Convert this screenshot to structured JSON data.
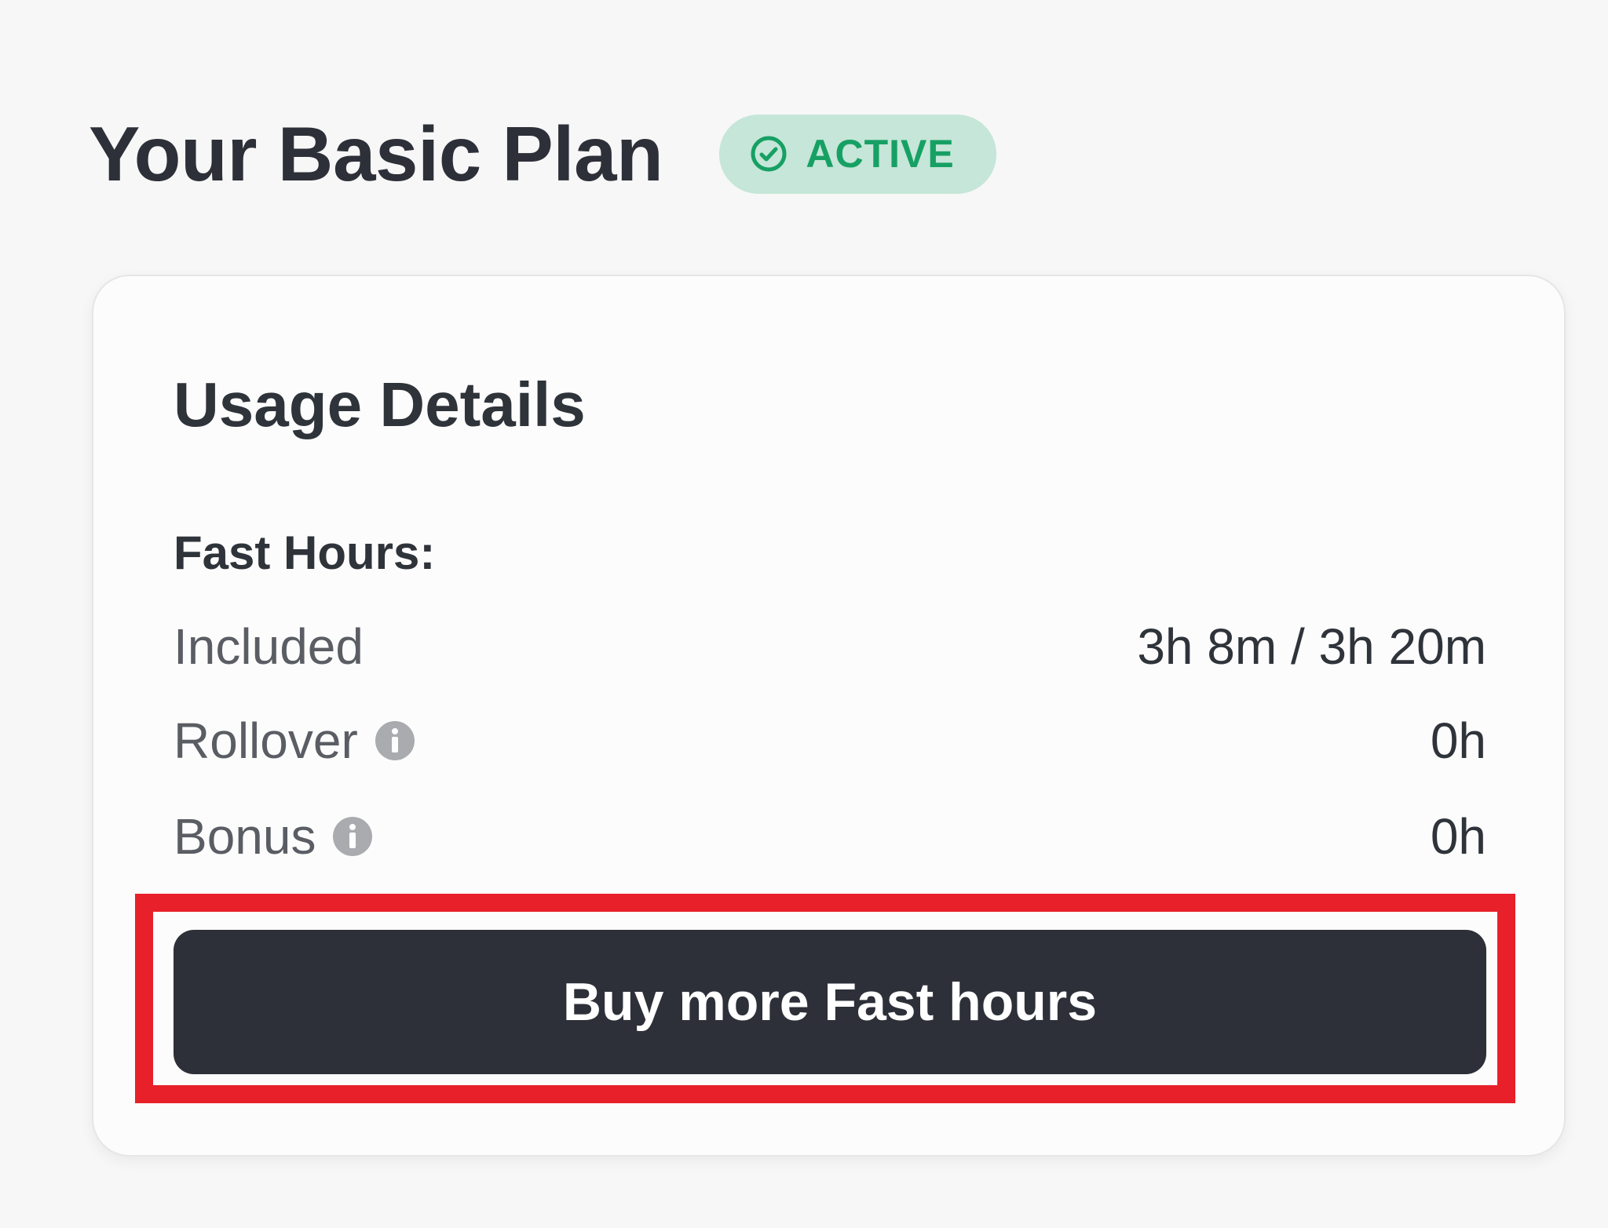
{
  "header": {
    "title": "Your Basic Plan",
    "status_badge": {
      "icon": "check-circle-icon",
      "label": "ACTIVE",
      "color": "#17a064",
      "background": "#c5e6d8"
    }
  },
  "usage_card": {
    "title": "Usage Details",
    "section_label": "Fast Hours:",
    "rows": [
      {
        "label": "Included",
        "value": "3h 8m / 3h 20m",
        "info_icon": null
      },
      {
        "label": "Rollover",
        "value": "0h",
        "info_icon": "info-icon"
      },
      {
        "label": "Bonus",
        "value": "0h",
        "info_icon": "info-icon"
      }
    ],
    "buy_button": {
      "label": "Buy more Fast hours",
      "background": "#2d3038"
    },
    "highlight_color": "#e8202a"
  }
}
